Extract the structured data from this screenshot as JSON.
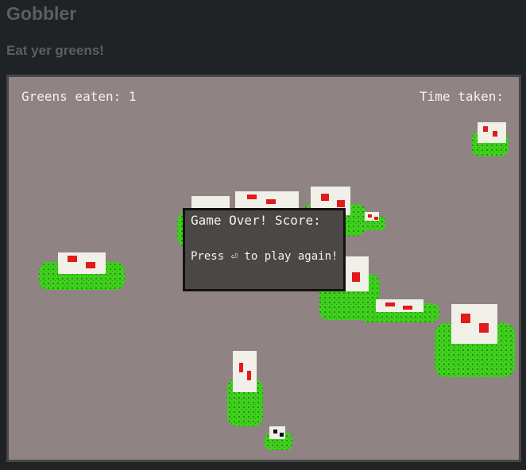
{
  "page": {
    "title": "Gobbler",
    "subtitle": "Eat yer greens!"
  },
  "hud": {
    "greens_label": "Greens eaten: 1",
    "time_label": "Time taken:"
  },
  "game_over": {
    "title": "Game Over! Score:",
    "hint": "Press ⏎ to play again!"
  },
  "colors": {
    "background": "#1f2325",
    "heading": "#5a5f61",
    "playfield": "#8f8483",
    "green": "#3fd01e",
    "green_dark": "#2a8f10",
    "sprout": "#f0efe8",
    "eye": "#e11a1a",
    "overlay_bg": "#4a4744"
  }
}
